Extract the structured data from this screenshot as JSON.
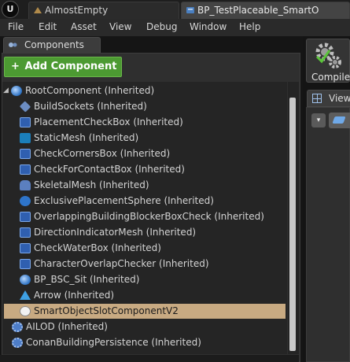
{
  "tabs": {
    "logo": "U",
    "items": [
      {
        "label": "AlmostEmpty",
        "active": false
      },
      {
        "label": "BP_TestPlaceable_SmartO",
        "active": true
      }
    ]
  },
  "menu": {
    "items": [
      "File",
      "Edit",
      "Asset",
      "View",
      "Debug",
      "Window",
      "Help"
    ]
  },
  "components_panel": {
    "tab_label": "Components",
    "add_button_label": "Add Component",
    "add_button_plus": "+",
    "add_button_caret": "▾",
    "tree": [
      {
        "label": "RootComponent (Inherited)",
        "icon": "scene-root-icon",
        "depth": 0,
        "expanded": true
      },
      {
        "label": "BuildSockets (Inherited)",
        "icon": "sockets-icon",
        "depth": 1
      },
      {
        "label": "PlacementCheckBox (Inherited)",
        "icon": "box-collision-icon",
        "depth": 1
      },
      {
        "label": "StaticMesh (Inherited)",
        "icon": "static-mesh-icon",
        "depth": 1
      },
      {
        "label": "CheckCornersBox (Inherited)",
        "icon": "box-collision-icon",
        "depth": 1
      },
      {
        "label": "CheckForContactBox (Inherited)",
        "icon": "box-collision-icon",
        "depth": 1
      },
      {
        "label": "SkeletalMesh (Inherited)",
        "icon": "skeletal-mesh-icon",
        "depth": 1
      },
      {
        "label": "ExclusivePlacementSphere (Inherited)",
        "icon": "sphere-collision-icon",
        "depth": 1
      },
      {
        "label": "OverlappingBuildingBlockerBoxCheck (Inherited)",
        "icon": "box-collision-icon",
        "depth": 1
      },
      {
        "label": "DirectionIndicatorMesh (Inherited)",
        "icon": "box-collision-icon",
        "depth": 1
      },
      {
        "label": "CheckWaterBox (Inherited)",
        "icon": "box-collision-icon",
        "depth": 1
      },
      {
        "label": "CharacterOverlapChecker (Inherited)",
        "icon": "box-collision-icon",
        "depth": 1
      },
      {
        "label": "BP_BSC_Sit (Inherited)",
        "icon": "scene-component-icon",
        "depth": 1
      },
      {
        "label": "Arrow (Inherited)",
        "icon": "arrow-icon",
        "depth": 1
      },
      {
        "label": "SmartObjectSlotComponentV2",
        "icon": "smart-object-icon",
        "depth": 1,
        "selected": true
      },
      {
        "label": "AILOD (Inherited)",
        "icon": "gear-component-icon",
        "depth": 0
      },
      {
        "label": "ConanBuildingPersistence (Inherited)",
        "icon": "gear-component-icon",
        "depth": 0
      }
    ]
  },
  "toolbar": {
    "compile_label": "Compile"
  },
  "view_panel": {
    "tab_label": "View"
  },
  "colors": {
    "add_button": "#4c9a32",
    "selection": "#c8aa82",
    "panel_bg": "#2f2f2f"
  }
}
